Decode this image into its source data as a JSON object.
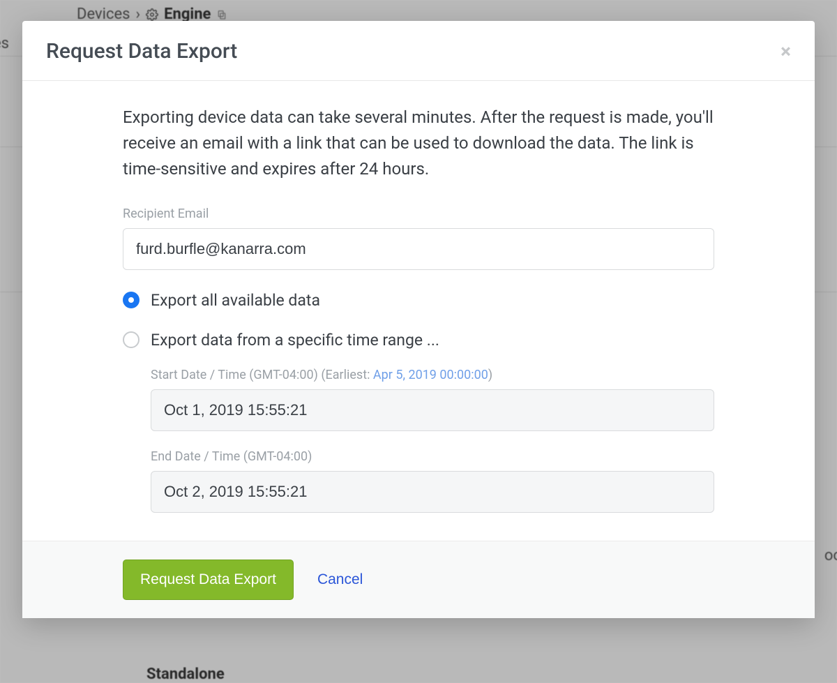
{
  "background": {
    "breadcrumb_parent": "Devices",
    "breadcrumb_sep": "›",
    "breadcrumb_current": "Engine",
    "side_truncated": "es",
    "right_truncated": "oose",
    "bottom_status": "Standalone"
  },
  "modal": {
    "title": "Request Data Export",
    "close_glyph": "×",
    "intro": "Exporting device data can take several minutes. After the request is made, you'll receive an email with a link that can be used to download the data. The link is time-sensitive and expires after 24 hours.",
    "recipient_label": "Recipient Email",
    "recipient_value": "furd.burfle@kanarra.com",
    "radio_all_label": "Export all available data",
    "radio_range_label": "Export data from a specific time range ...",
    "radio_selected": "all",
    "start": {
      "label_prefix": "Start Date / Time (GMT-04:00) (Earliest: ",
      "label_link": "Apr 5, 2019 00:00:00",
      "label_suffix": ")",
      "value": "Oct 1, 2019 15:55:21"
    },
    "end": {
      "label": "End Date / Time (GMT-04:00)",
      "value": "Oct 2, 2019 15:55:21"
    },
    "footer": {
      "submit_label": "Request Data Export",
      "cancel_label": "Cancel"
    }
  }
}
